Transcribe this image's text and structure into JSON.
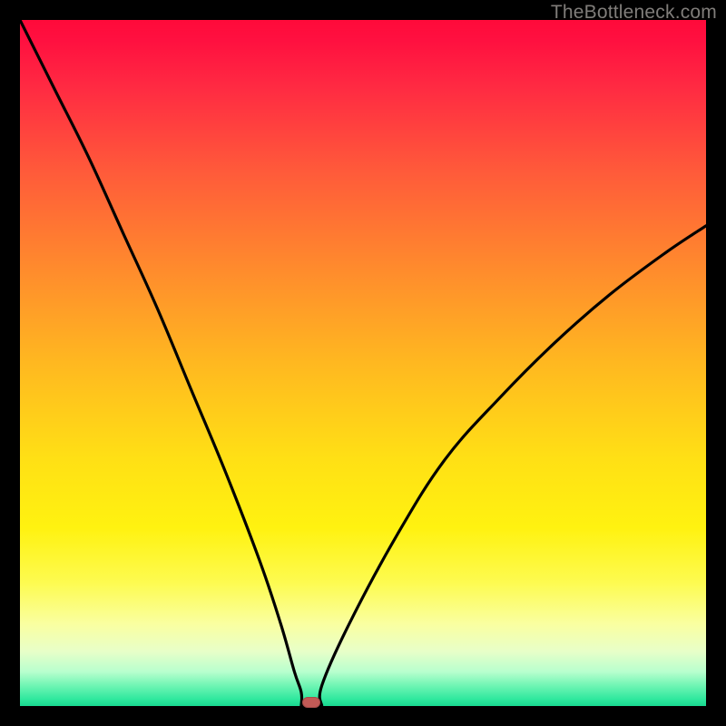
{
  "watermark": "TheBottleneck.com",
  "chart_data": {
    "type": "line",
    "title": "",
    "xlabel": "",
    "ylabel": "",
    "xlim": [
      0,
      100
    ],
    "ylim": [
      0,
      100
    ],
    "grid": false,
    "legend": false,
    "gradient_stops": [
      {
        "pos": 0,
        "color": "#ff0a3a"
      },
      {
        "pos": 50,
        "color": "#ffd818"
      },
      {
        "pos": 88,
        "color": "#faffa0"
      },
      {
        "pos": 100,
        "color": "#18d890"
      }
    ],
    "series": [
      {
        "name": "bottleneck-curve",
        "x": [
          0,
          5,
          10,
          15,
          20,
          25,
          30,
          35,
          38,
          40,
          41,
          42,
          43,
          44,
          48,
          55,
          62,
          70,
          78,
          86,
          94,
          100
        ],
        "y": [
          100,
          90,
          80,
          69,
          58,
          46,
          34,
          21,
          12,
          5,
          2,
          0,
          0,
          3,
          12,
          25,
          36,
          45,
          53,
          60,
          66,
          70
        ]
      }
    ],
    "marker": {
      "x": 42.5,
      "y": 0.5,
      "color": "#c25a56"
    },
    "flat_bottom": {
      "x_start": 41,
      "x_end": 44,
      "y": 0
    }
  }
}
